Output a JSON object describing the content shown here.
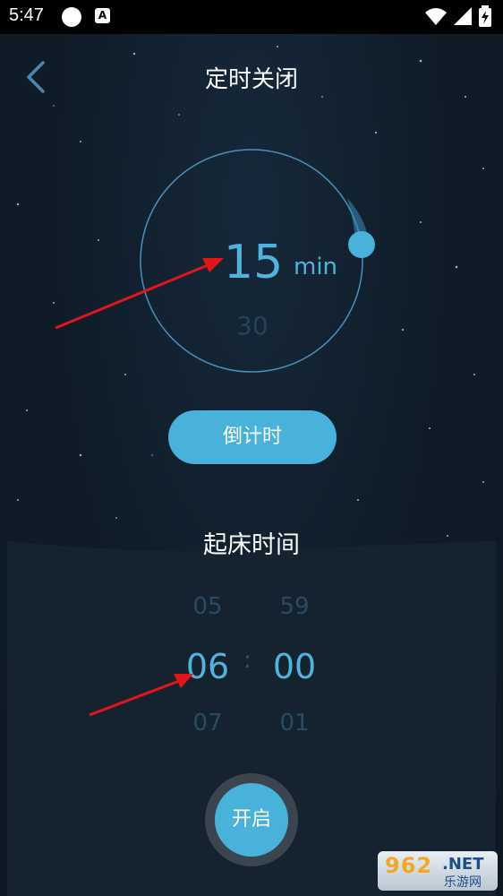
{
  "status_bar": {
    "time": "5:47",
    "badge_letter": "A",
    "icons": [
      "circle-icon",
      "accessibility-icon",
      "wifi-icon",
      "signal-icon",
      "battery-icon"
    ]
  },
  "header": {
    "title": "定时关闭",
    "back_icon": "chevron-left-icon"
  },
  "timer": {
    "current_minutes": "15",
    "unit": "min",
    "next_minutes": "30",
    "progress_fraction": 0.02
  },
  "countdown_button": {
    "label": "倒计时"
  },
  "wake": {
    "title": "起床时间",
    "hours": {
      "prev": "05",
      "selected": "06",
      "next": "07"
    },
    "minutes": {
      "prev": "59",
      "selected": "00",
      "next": "01"
    },
    "separator": ":"
  },
  "start_button": {
    "label": "开启"
  },
  "watermark": {
    "number": "962",
    "suffix": ".NET",
    "sub": "乐游网"
  },
  "colors": {
    "accent": "#49b2db",
    "accent_text": "#4fb3dc",
    "background": "#0f1a24",
    "annotation_arrow": "#e0161a"
  }
}
